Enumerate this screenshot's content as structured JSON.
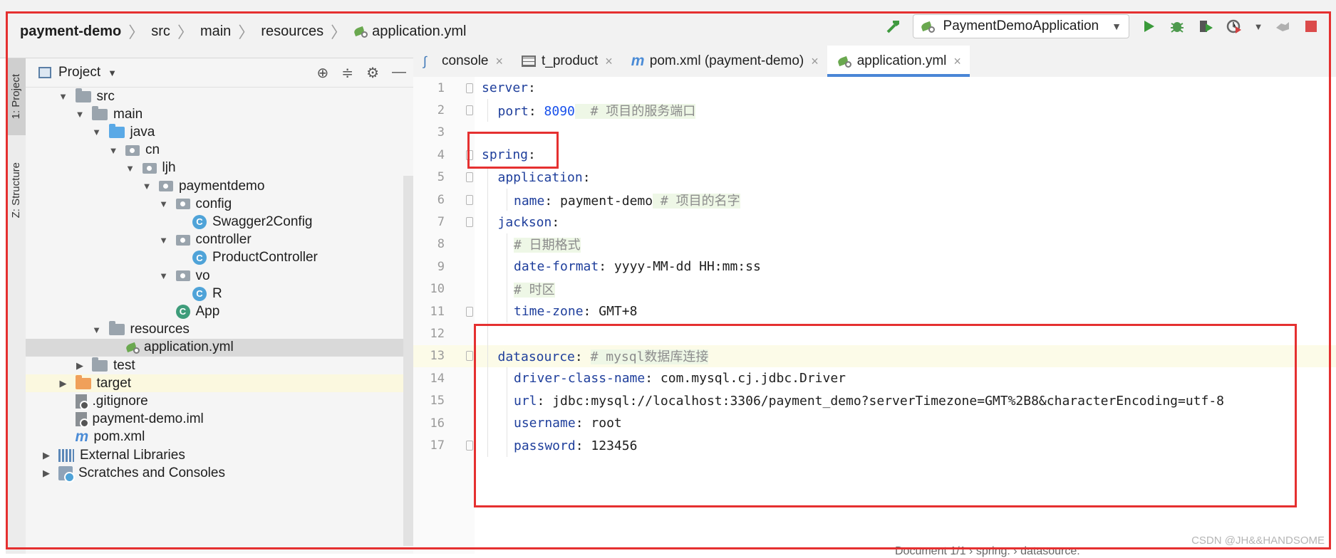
{
  "breadcrumb": {
    "items": [
      "payment-demo",
      "src",
      "main",
      "resources",
      "application.yml"
    ]
  },
  "toolbar": {
    "run_config": "PaymentDemoApplication",
    "icons": [
      "build-hammer-icon",
      "run-icon",
      "debug-icon",
      "coverage-icon",
      "profile-icon",
      "stop-icon"
    ]
  },
  "side_tabs": {
    "project": "1: Project",
    "structure": "Z: Structure"
  },
  "project_panel": {
    "title": "Project",
    "tree": [
      {
        "label": "src",
        "depth": 1,
        "type": "folder",
        "expanded": true
      },
      {
        "label": "main",
        "depth": 2,
        "type": "folder",
        "expanded": true
      },
      {
        "label": "java",
        "depth": 3,
        "type": "folder-blue",
        "expanded": true
      },
      {
        "label": "cn",
        "depth": 4,
        "type": "package",
        "expanded": true
      },
      {
        "label": "ljh",
        "depth": 5,
        "type": "package",
        "expanded": true
      },
      {
        "label": "paymentdemo",
        "depth": 6,
        "type": "package",
        "expanded": true
      },
      {
        "label": "config",
        "depth": 7,
        "type": "package",
        "expanded": true
      },
      {
        "label": "Swagger2Config",
        "depth": 8,
        "type": "class"
      },
      {
        "label": "controller",
        "depth": 7,
        "type": "package",
        "expanded": true
      },
      {
        "label": "ProductController",
        "depth": 8,
        "type": "class"
      },
      {
        "label": "vo",
        "depth": 7,
        "type": "package",
        "expanded": true
      },
      {
        "label": "R",
        "depth": 8,
        "type": "class"
      },
      {
        "label": "App",
        "depth": 7,
        "type": "class-app"
      },
      {
        "label": "resources",
        "depth": 3,
        "type": "folder-res",
        "expanded": true
      },
      {
        "label": "application.yml",
        "depth": 4,
        "type": "yml",
        "selected": true
      },
      {
        "label": "test",
        "depth": 2,
        "type": "folder",
        "expanded": false
      },
      {
        "label": "target",
        "depth": 1,
        "type": "folder-orange",
        "expanded": false,
        "highlight": true
      },
      {
        "label": ".gitignore",
        "depth": 1,
        "type": "file"
      },
      {
        "label": "payment-demo.iml",
        "depth": 1,
        "type": "file"
      },
      {
        "label": "pom.xml",
        "depth": 1,
        "type": "maven"
      },
      {
        "label": "External Libraries",
        "depth": 0,
        "type": "libraries",
        "expanded": false
      },
      {
        "label": "Scratches and Consoles",
        "depth": 0,
        "type": "scratches",
        "expanded": false
      }
    ]
  },
  "editor_tabs": [
    {
      "label": "console",
      "icon": "console-icon",
      "active": false
    },
    {
      "label": "t_product",
      "icon": "table-icon",
      "active": false
    },
    {
      "label": "pom.xml (payment-demo)",
      "icon": "maven-icon",
      "active": false
    },
    {
      "label": "application.yml",
      "icon": "yml-icon",
      "active": true
    }
  ],
  "editor": {
    "current_line": 13,
    "lines": [
      {
        "n": "1",
        "indent": 0,
        "key": "server",
        "sep": ":",
        "value": "",
        "value_type": "",
        "comment": ""
      },
      {
        "n": "2",
        "indent": 1,
        "key": "port",
        "sep": ": ",
        "value": "8090",
        "value_type": "number",
        "comment": "  # 项目的服务端口"
      },
      {
        "n": "3",
        "indent": 0,
        "key": "",
        "sep": "",
        "value": "",
        "value_type": "",
        "comment": ""
      },
      {
        "n": "4",
        "indent": 0,
        "key": "spring",
        "sep": ":",
        "value": "",
        "value_type": "",
        "comment": ""
      },
      {
        "n": "5",
        "indent": 1,
        "key": "application",
        "sep": ":",
        "value": "",
        "value_type": "",
        "comment": ""
      },
      {
        "n": "6",
        "indent": 2,
        "key": "name",
        "sep": ": ",
        "value": "payment-demo",
        "value_type": "text",
        "comment": " # 项目的名字"
      },
      {
        "n": "7",
        "indent": 1,
        "key": "jackson",
        "sep": ":",
        "value": "",
        "value_type": "",
        "comment": ""
      },
      {
        "n": "8",
        "indent": 2,
        "key": "",
        "sep": "",
        "value": "",
        "value_type": "",
        "comment": "# 日期格式"
      },
      {
        "n": "9",
        "indent": 2,
        "key": "date-format",
        "sep": ": ",
        "value": "yyyy-MM-dd HH:mm:ss",
        "value_type": "text",
        "comment": ""
      },
      {
        "n": "10",
        "indent": 2,
        "key": "",
        "sep": "",
        "value": "",
        "value_type": "",
        "comment": "# 时区"
      },
      {
        "n": "11",
        "indent": 2,
        "key": "time-zone",
        "sep": ": ",
        "value": "GMT+8",
        "value_type": "text",
        "comment": ""
      },
      {
        "n": "12",
        "indent": 0,
        "key": "",
        "sep": "",
        "value": "",
        "value_type": "",
        "comment": ""
      },
      {
        "n": "13",
        "indent": 1,
        "key": "datasource",
        "sep": ": ",
        "value": "",
        "value_type": "",
        "comment": "# mysql数据库连接"
      },
      {
        "n": "14",
        "indent": 2,
        "key": "driver-class-name",
        "sep": ": ",
        "value": "com.mysql.cj.jdbc.Driver",
        "value_type": "text",
        "comment": ""
      },
      {
        "n": "15",
        "indent": 2,
        "key": "url",
        "sep": ": ",
        "value": "jdbc:mysql://localhost:3306/payment_demo?serverTimezone=GMT%2B8&characterEncoding=utf-8",
        "value_type": "text",
        "comment": ""
      },
      {
        "n": "16",
        "indent": 2,
        "key": "username",
        "sep": ": ",
        "value": "root",
        "value_type": "text",
        "comment": ""
      },
      {
        "n": "17",
        "indent": 2,
        "key": "password",
        "sep": ": ",
        "value": "123456",
        "value_type": "text",
        "comment": ""
      }
    ],
    "status_crumbs": "Document 1/1  ›  spring:  ›  datasource:"
  },
  "watermark": "CSDN @JH&&HANDSOME",
  "colors": {
    "annotation_red": "#e53030",
    "yaml_key": "#1f3f9c",
    "yaml_number": "#1750eb",
    "active_tab_underline": "#4a86d6"
  }
}
